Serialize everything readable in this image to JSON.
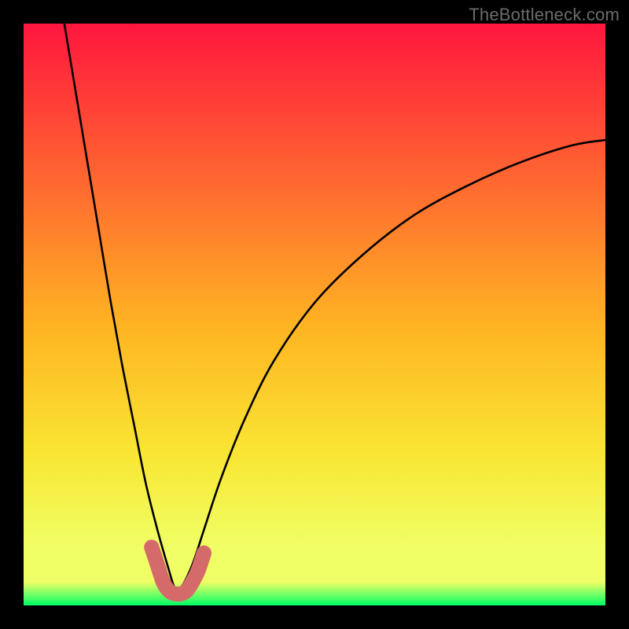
{
  "watermark": "TheBottleneck.com",
  "colors": {
    "bg_black": "#000000",
    "grad_top": "#ff163e",
    "grad_mid1": "#ff6a30",
    "grad_mid2": "#ffb422",
    "grad_mid3": "#f9e633",
    "grad_band": "#f0ff66",
    "grad_bottom": "#00ff66",
    "curve": "#000000",
    "marker": "#d46a6a",
    "marker_fill": "#d46a6a"
  },
  "chart_data": {
    "type": "line",
    "title": "",
    "xlabel": "",
    "ylabel": "",
    "xlim": [
      0,
      100
    ],
    "ylim": [
      0,
      100
    ],
    "notes": "Gradient background red→orange→yellow→green with a black bottleneck curve. Curve minimum around x≈26, y≈0. Marker short U-shaped segment highlighted in muted red near the minimum.",
    "series": [
      {
        "name": "bottleneck-curve",
        "x": [
          7,
          9,
          11,
          13,
          15,
          17,
          19,
          21,
          23,
          25,
          26,
          27,
          29,
          31,
          34,
          38,
          43,
          50,
          58,
          67,
          76,
          85,
          94,
          100
        ],
        "values": [
          100,
          88,
          76,
          64,
          52,
          41,
          31,
          21,
          13,
          6,
          3,
          3,
          7,
          13,
          22,
          32,
          42,
          52,
          60,
          67,
          72,
          76,
          79,
          80
        ]
      },
      {
        "name": "highlight-marker",
        "x": [
          22,
          23,
          24,
          25,
          26,
          27,
          28,
          29,
          30,
          31
        ],
        "values": [
          10,
          7,
          4,
          2.5,
          2,
          2,
          2.5,
          4,
          6,
          9
        ]
      }
    ]
  }
}
